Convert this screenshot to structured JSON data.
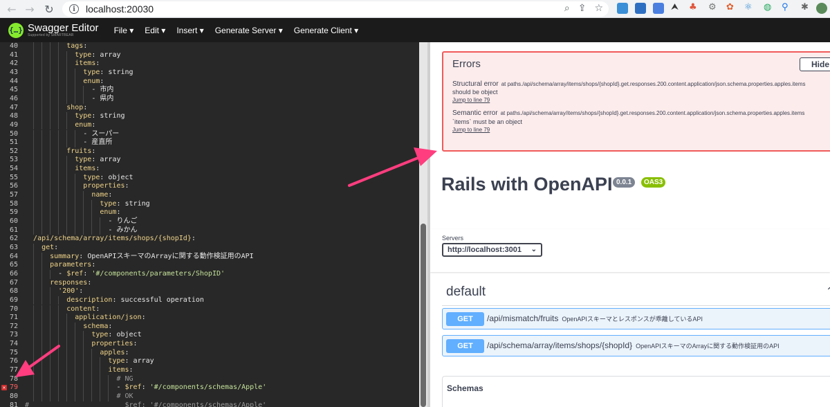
{
  "browser": {
    "url": "localhost:20030",
    "icons": {
      "back": "back-arrow-icon",
      "forward": "forward-arrow-icon",
      "reload": "reload-icon",
      "site_info": "info-icon",
      "zoom": "zoom-icon",
      "share": "share-icon",
      "bookmark": "star-icon"
    }
  },
  "topbar": {
    "logo_title": "Swagger Editor",
    "logo_sub": "Supported by SMARTBEAR",
    "menu": [
      {
        "label": "File ▾"
      },
      {
        "label": "Edit ▾"
      },
      {
        "label": "Insert ▾"
      },
      {
        "label": "Generate Server ▾"
      },
      {
        "label": "Generate Client ▾"
      }
    ]
  },
  "editor": {
    "lines": [
      {
        "n": "40",
        "code": "          tags:"
      },
      {
        "n": "41",
        "code": "            type: array"
      },
      {
        "n": "42",
        "code": "            items:"
      },
      {
        "n": "43",
        "code": "              type: string"
      },
      {
        "n": "44",
        "code": "              enum:"
      },
      {
        "n": "45",
        "code": "                - 市内"
      },
      {
        "n": "46",
        "code": "                - 県内"
      },
      {
        "n": "47",
        "code": "          shop:"
      },
      {
        "n": "48",
        "code": "            type: string"
      },
      {
        "n": "49",
        "code": "            enum:"
      },
      {
        "n": "50",
        "code": "              - スーパー"
      },
      {
        "n": "51",
        "code": "              - 産直所"
      },
      {
        "n": "52",
        "code": "          fruits:"
      },
      {
        "n": "53",
        "code": "            type: array"
      },
      {
        "n": "54",
        "code": "            items:"
      },
      {
        "n": "55",
        "code": "              type: object"
      },
      {
        "n": "56",
        "code": "              properties:"
      },
      {
        "n": "57",
        "code": "                name:"
      },
      {
        "n": "58",
        "code": "                  type: string"
      },
      {
        "n": "59",
        "code": "                  enum:"
      },
      {
        "n": "60",
        "code": "                    - りんご"
      },
      {
        "n": "61",
        "code": "                    - みかん"
      },
      {
        "n": "62",
        "code": "  /api/schema/array/items/shops/{shopId}:"
      },
      {
        "n": "63",
        "code": "    get:"
      },
      {
        "n": "64",
        "code": "      summary: OpenAPIスキーマのArrayに関する動作検証用のAPI"
      },
      {
        "n": "65",
        "code": "      parameters:"
      },
      {
        "n": "66",
        "code": "        - $ref: '#/components/parameters/ShopID'"
      },
      {
        "n": "67",
        "code": "      responses:"
      },
      {
        "n": "68",
        "code": "        '200':"
      },
      {
        "n": "69",
        "code": "          description: successful operation"
      },
      {
        "n": "70",
        "code": "          content:"
      },
      {
        "n": "71",
        "code": "            application/json:"
      },
      {
        "n": "72",
        "code": "              schema:"
      },
      {
        "n": "73",
        "code": "                type: object"
      },
      {
        "n": "74",
        "code": "                properties:"
      },
      {
        "n": "75",
        "code": "                  apples:"
      },
      {
        "n": "76",
        "code": "                    type: array"
      },
      {
        "n": "77",
        "code": "                    items:"
      },
      {
        "n": "78",
        "code": "                      # NG"
      },
      {
        "n": "79",
        "code": "                      - $ref: '#/components/schemas/Apple'",
        "error": true
      },
      {
        "n": "80",
        "code": "                      # OK"
      },
      {
        "n": "81",
        "code": "#                       $ref: '#/components/schemas/Apple'"
      }
    ]
  },
  "errors": {
    "title": "Errors",
    "hide_label": "Hide",
    "items": [
      {
        "kind": "Structural error",
        "path": "at paths./api/schema/array/items/shops/{shopId}.get.responses.200.content.application/json.schema.properties.apples.items",
        "message": "should be object",
        "jump": "Jump to line 79"
      },
      {
        "kind": "Semantic error",
        "path": "at paths./api/schema/array/items/shops/{shopId}.get.responses.200.content.application/json.schema.properties.apples.items",
        "message": "`items` must be an object",
        "jump": "Jump to line 79"
      }
    ]
  },
  "info": {
    "title": "Rails with OpenAPI",
    "version": "0.0.1",
    "oas": "OAS3"
  },
  "servers": {
    "label": "Servers",
    "selected": "http://localhost:3001",
    "caret": "⌄"
  },
  "tag": {
    "name": "default",
    "caret": "⌃"
  },
  "operations": [
    {
      "method": "GET",
      "path": "/api/mismatch/fruits",
      "summary": "OpenAPIスキーマとレスポンスが乖離しているAPI"
    },
    {
      "method": "GET",
      "path": "/api/schema/array/items/shops/{shopId}",
      "summary": "OpenAPIスキーマのArrayに関する動作検証用のAPI"
    }
  ],
  "schemas": {
    "title": "Schemas"
  },
  "colors": {
    "editor_bg": "#282828",
    "topbar_bg": "#1b1b1b",
    "error_border": "#f05a5a",
    "get_blue": "#61affe",
    "annotation_arrow": "#ff3d7f"
  }
}
